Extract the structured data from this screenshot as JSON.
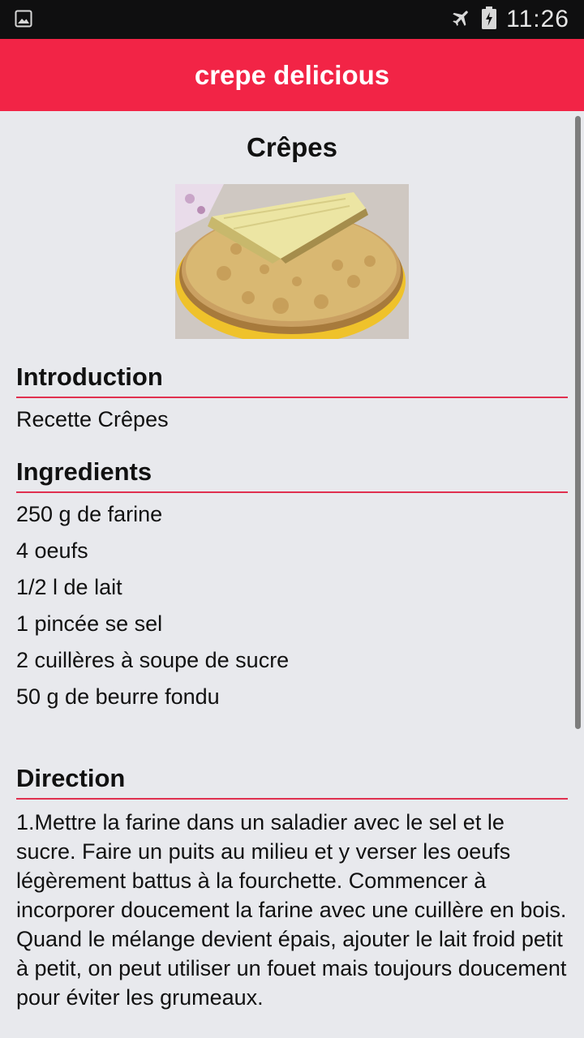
{
  "status_bar": {
    "time": "11:26",
    "left_icon": "image-notification-icon",
    "right_icons": [
      "airplane-mode-icon",
      "battery-charging-icon"
    ]
  },
  "app_bar": {
    "title": "crepe delicious"
  },
  "recipe": {
    "title": "Crêpes",
    "image": "crepes-photo",
    "introduction": {
      "heading": "Introduction",
      "text": "Recette Crêpes"
    },
    "ingredients": {
      "heading": "Ingredients",
      "items": [
        "250 g de farine",
        "4 oeufs",
        "1/2 l de lait",
        "1 pincée se sel",
        "2 cuillères à soupe de sucre",
        "50 g de beurre fondu"
      ]
    },
    "direction": {
      "heading": "Direction",
      "text": "1.Mettre la farine dans un saladier avec le sel et le sucre. Faire un puits au milieu et y verser les oeufs légèrement battus à la fourchette. Commencer à incorporer doucement la farine avec une cuillère en bois. Quand le mélange devient épais, ajouter le lait froid petit à petit, on peut utiliser un fouet mais toujours doucement pour éviter les grumeaux."
    }
  },
  "colors": {
    "accent": "#f22446",
    "divider": "#e0304f",
    "background": "#e8e9ed",
    "status_bar": "#0f0f10"
  }
}
